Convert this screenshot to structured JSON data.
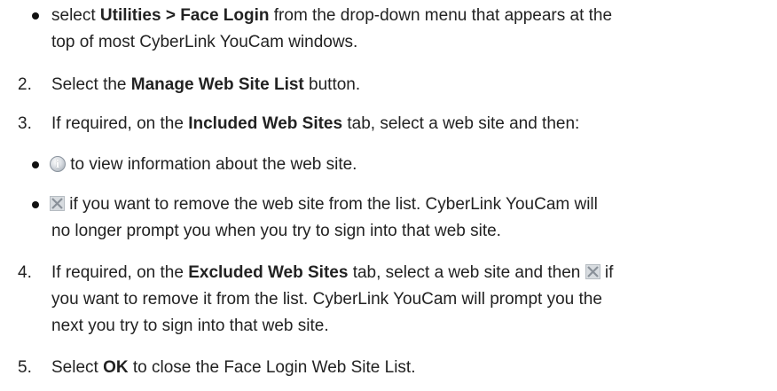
{
  "bullet_a": {
    "l1_pre": "select ",
    "l1_bold": "Utilities > Face Login",
    "l1_post": " from the drop-down menu that appears at the",
    "l2": "top of most CyberLink YouCam windows."
  },
  "step2": {
    "num": "2.",
    "pre": "Select the ",
    "bold": "Manage Web Site List",
    "post": " button."
  },
  "step3": {
    "num": "3.",
    "pre": "If required, on the ",
    "bold": "Included Web Sites",
    "post": " tab, select a web site and then:"
  },
  "bullet_b": {
    "text": " to view information about the web site."
  },
  "bullet_c": {
    "l1": " if you want to remove the web site from the list. CyberLink YouCam will",
    "l2": "no longer prompt you when you try to sign into that web site."
  },
  "step4": {
    "num": "4.",
    "l1_pre": "If required, on the ",
    "l1_bold": "Excluded Web Sites",
    "l1_post": " tab, select a web site and then ",
    "l1_end": " if",
    "l2": "you want to remove it from the list. CyberLink YouCam will prompt you the",
    "l3": "next you try to sign into that web site."
  },
  "step5": {
    "num": "5.",
    "pre": "Select ",
    "bold": "OK",
    "post": " to close the Face Login Web Site List."
  },
  "icons": {
    "info": "info-icon",
    "remove": "remove-x-icon"
  }
}
